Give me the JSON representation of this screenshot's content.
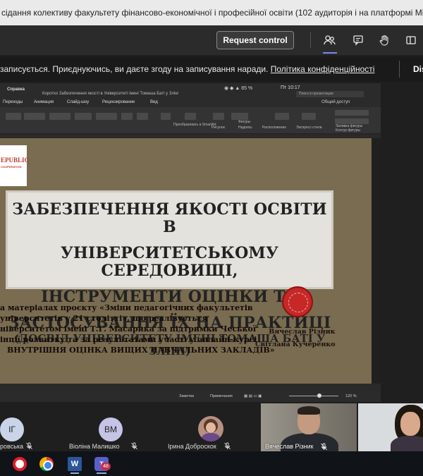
{
  "window": {
    "title": "сідання колективу факультету фінансово-економічної і професійної освіти (102 аудиторія і на платформі Microsoft Team"
  },
  "controls": {
    "request_control": "Request control",
    "icons": [
      "people-icon",
      "chat-icon",
      "raise-hand-icon",
      "share-tray-icon"
    ]
  },
  "banner": {
    "text": "записується. Приєднуючись, ви даєте згоду на записування наради.",
    "link": "Політика конфіденційності",
    "dismiss": "Dis"
  },
  "powerpoint": {
    "help_menu": "Справка",
    "doc_title": "Коротко Забезпечення якості в Університеті імені Томаша Баті у Зліні",
    "time": "Пт 10:17",
    "battery": "85 %",
    "search_placeholder": "Поиск в презентации",
    "tabs": [
      "Переходы",
      "Анимация",
      "Слайд-шоу",
      "Рецензирование",
      "Вид"
    ],
    "share_label": "Общий доступ",
    "ribbon_labels": [
      "Рисунок",
      "Фигуры",
      "Надпись",
      "Расположение",
      "Экспресс-стили",
      "Заливка фигуры",
      "Контур фигуры",
      "Преобразовать в SmartArt"
    ],
    "status_left": "Заметки",
    "status_comments": "Примечания",
    "zoom": "120 %"
  },
  "slide": {
    "logo_top": "EPUBLIC",
    "logo_bottom": "COOPERATION",
    "title_lines": [
      "ЗАБЕЗПЕЧЕННЯ ЯКОСТІ ОСВІТИ В",
      "УНІВЕРСИТЕТСЬКОМУ СЕРЕДОВИЩІ,",
      "ІНСТРУМЕНТИ ОЦІНКИ ТА",
      "ЗАСТОСУВАННЯ ЇХ НА ПРАКТИЦІ"
    ],
    "subtitle": "(ДОСВІД УНІВЕРСИТЕТУ ІМЕНІ ТОМАША БАТІ У ЗЛІНІ)",
    "description_lines": [
      "а матеріалах проєкту «Зміни педагогічних факультетів",
      "університетів у 21 столітті», що реалізується",
      "ніверситетом імені Т.Г. Масарика за підтримки Чеської",
      "інції розвитку та за результатами участі у онлайн-курсі",
      "ВНУТРІШНЯ ОЦІНКА  ВИЩИХ НАВЧАЛЬНИХ ЗАКЛАДІВ»"
    ],
    "authors": [
      "Вячеслав Різник",
      "Світлана Кучеренко"
    ]
  },
  "participants": [
    {
      "initials": "ІГ",
      "name": "ровська",
      "color": "#c9d4e8"
    },
    {
      "initials": "ВМ",
      "name": "Віоліна Малишко",
      "color": "#c5c3e6"
    },
    {
      "initials": "",
      "name": "Ірина Доброскок",
      "color": ""
    }
  ],
  "video_tiles": [
    {
      "name": "Вячеслав Різник"
    }
  ],
  "taskbar": {
    "apps": [
      "opera-icon",
      "chrome-icon",
      "word-icon",
      "teams-icon"
    ],
    "word_letter": "W",
    "teams_letter": "T",
    "teams_badge": "48"
  }
}
